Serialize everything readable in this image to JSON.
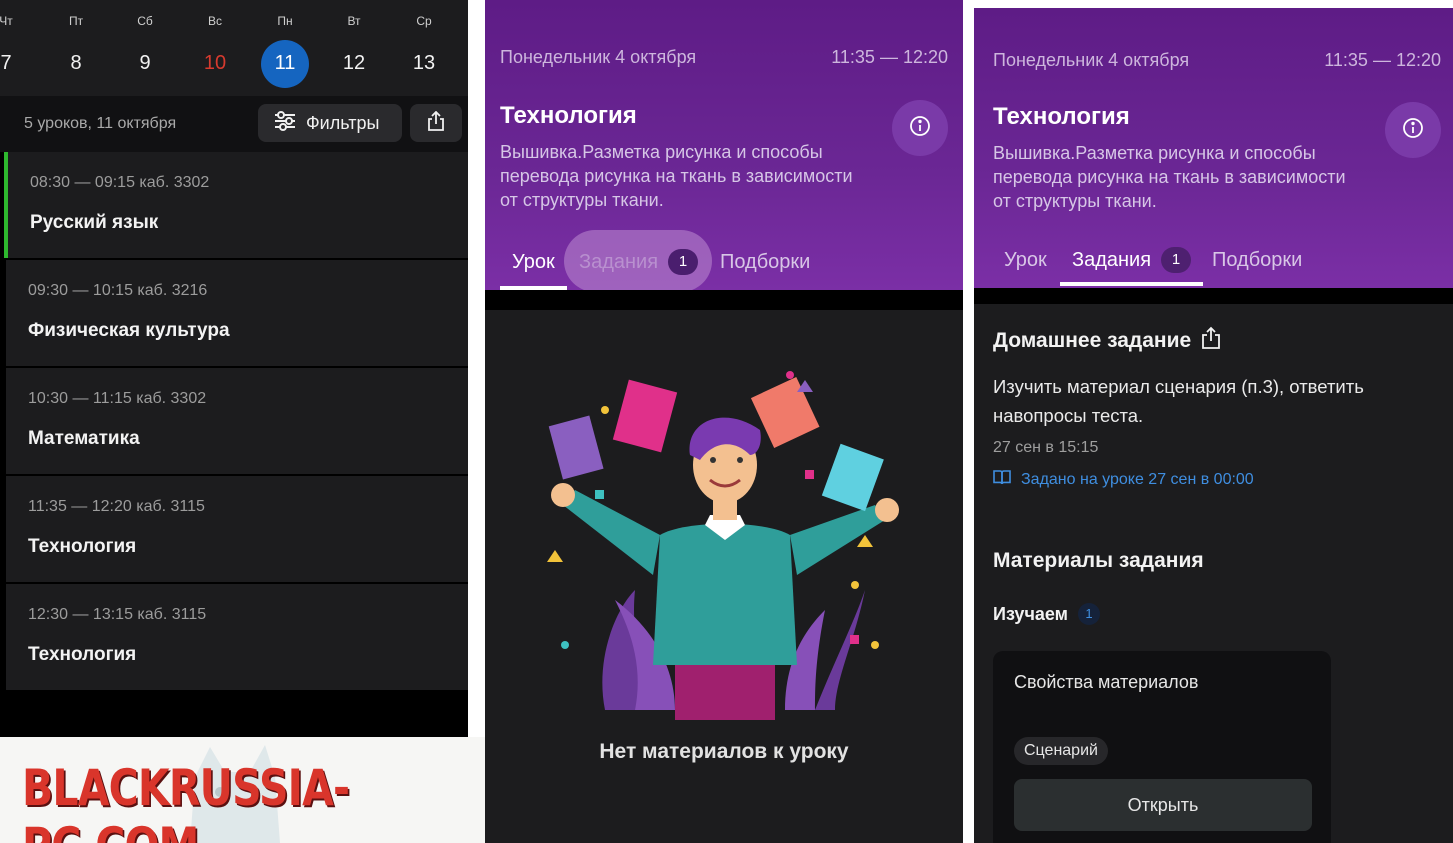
{
  "schedule": {
    "week": [
      {
        "dow": "Чт",
        "day": "7"
      },
      {
        "dow": "Пт",
        "day": "8"
      },
      {
        "dow": "Сб",
        "day": "9"
      },
      {
        "dow": "Вс",
        "day": "10"
      },
      {
        "dow": "Пн",
        "day": "11"
      },
      {
        "dow": "Вт",
        "day": "12"
      },
      {
        "dow": "Ср",
        "day": "13"
      }
    ],
    "selected_day": "11",
    "summary": "5 уроков, 11 октября",
    "filters_label": "Фильтры",
    "lessons": [
      {
        "time": "08:30 — 09:15  каб. 3302",
        "subject": "Русский язык"
      },
      {
        "time": "09:30 — 10:15  каб. 3216",
        "subject": "Физическая культура"
      },
      {
        "time": "10:30 — 11:15  каб. 3302",
        "subject": "Математика"
      },
      {
        "time": "11:35 — 12:20  каб. 3115",
        "subject": "Технология"
      },
      {
        "time": "12:30 — 13:15  каб. 3115",
        "subject": "Технология"
      }
    ]
  },
  "watermark": "BLACKRUSSIA-PC.COM",
  "lesson_view": {
    "date": "Понедельник 4 октября",
    "time": "11:35 — 12:20",
    "title": "Технология",
    "description": "Вышивка.Разметка рисунка и способы перевода рисунка на ткань в зависимости от структуры ткани.",
    "tabs": [
      {
        "label": "Урок"
      },
      {
        "label": "Задания",
        "badge": "1"
      },
      {
        "label": "Подборки"
      }
    ],
    "empty_text": "Нет материалов к уроку"
  },
  "homework_view": {
    "heading": "Домашнее задание",
    "text": "Изучить материал сценария (п.3), ответить навопросы теста.",
    "due": "27 сен в 15:15",
    "given": "Задано на уроке 27 сен в 00:00",
    "materials_heading": "Материалы задания",
    "study_label": "Изучаем",
    "study_count": "1",
    "card_title": "Свойства материалов",
    "card_chip": "Сценарий",
    "open_label": "Открыть"
  },
  "colors": {
    "accent_blue": "#1565c0",
    "current_lesson_green": "#2eb82e",
    "header_purple": "#6b2795",
    "link_blue": "#3f8ee0",
    "sunday_red": "#d63a2e"
  }
}
